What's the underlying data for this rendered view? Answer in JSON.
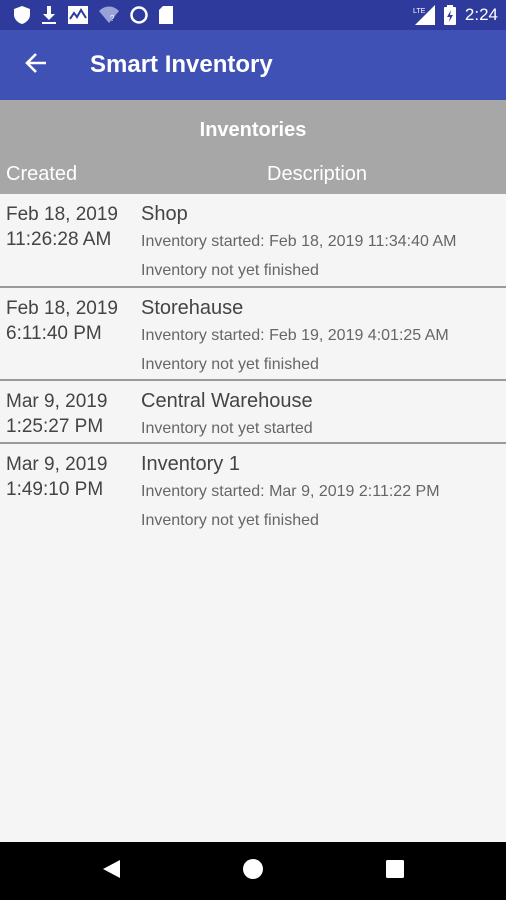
{
  "status_bar": {
    "time": "2:24",
    "left_icons": [
      "shield-icon",
      "download-icon",
      "activity-icon",
      "wifi-icon",
      "circle-icon",
      "sd-card-icon"
    ],
    "right_icons": [
      "lte-signal-icon",
      "battery-icon"
    ]
  },
  "app_bar": {
    "title": "Smart Inventory",
    "back_icon": "arrow-left-icon"
  },
  "table": {
    "title": "Inventories",
    "columns": {
      "created": "Created",
      "description": "Description"
    },
    "rows": [
      {
        "created_date": "Feb 18, 2019",
        "created_time": "11:26:28 AM",
        "name": "Shop",
        "details": [
          "Inventory started: Feb 18, 2019 11:34:40 AM",
          "Inventory not yet finished"
        ]
      },
      {
        "created_date": "Feb 18, 2019",
        "created_time": "6:11:40 PM",
        "name": "Storehause",
        "details": [
          "Inventory started: Feb 19, 2019 4:01:25 AM",
          "Inventory not yet finished"
        ]
      },
      {
        "created_date": "Mar 9, 2019",
        "created_time": "1:25:27 PM",
        "name": "Central Warehouse",
        "details": [
          "Inventory not yet started"
        ]
      },
      {
        "created_date": "Mar 9, 2019",
        "created_time": "1:49:10 PM",
        "name": "Inventory 1",
        "details": [
          "Inventory started: Mar 9, 2019 2:11:22 PM",
          "Inventory not yet finished"
        ]
      }
    ]
  },
  "nav_bar": {
    "icons": [
      "back-triangle-icon",
      "home-circle-icon",
      "recents-square-icon"
    ]
  },
  "colors": {
    "status_bar": "#2e3b9c",
    "app_bar": "#3f51b5",
    "table_header": "#a7a7a7",
    "background": "#f5f5f5"
  }
}
